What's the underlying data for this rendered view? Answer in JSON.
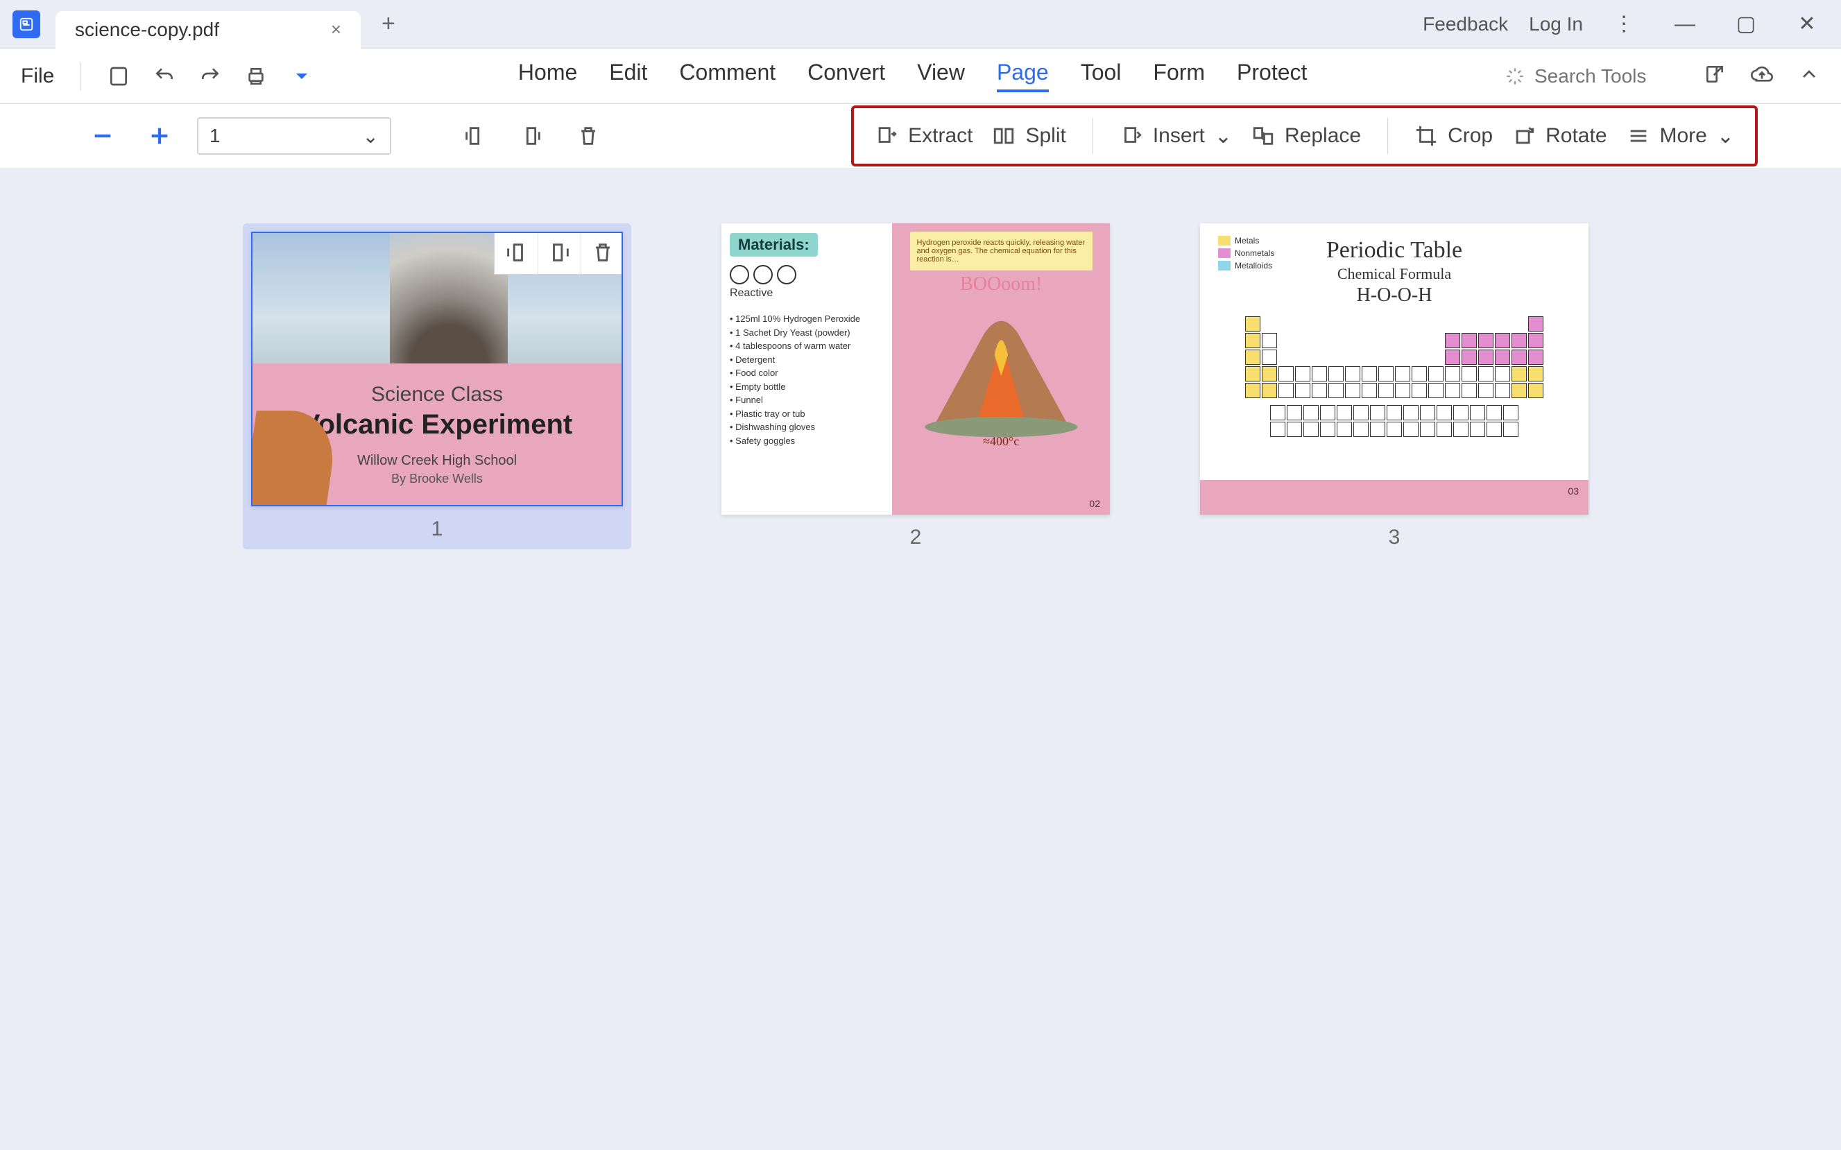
{
  "titlebar": {
    "filename": "science-copy.pdf",
    "feedback": "Feedback",
    "login": "Log In"
  },
  "file_label": "File",
  "menu": {
    "home": "Home",
    "edit": "Edit",
    "comment": "Comment",
    "convert": "Convert",
    "view": "View",
    "page": "Page",
    "tool": "Tool",
    "form": "Form",
    "protect": "Protect"
  },
  "search_placeholder": "Search Tools",
  "page_input": "1",
  "page_tools": {
    "extract": "Extract",
    "split": "Split",
    "insert": "Insert",
    "replace": "Replace",
    "crop": "Crop",
    "rotate": "Rotate",
    "more": "More"
  },
  "thumbs": {
    "p1": {
      "num": "1",
      "line1": "Science Class",
      "line2": "Volcanic Experiment",
      "line3": "Willow Creek High School",
      "line4": "By Brooke Wells"
    },
    "p2": {
      "num": "2",
      "materials_badge": "Materials:",
      "mol_label": "Reactive",
      "list": [
        "• 125ml 10% Hydrogen Peroxide",
        "• 1 Sachet Dry Yeast (powder)",
        "• 4 tablespoons of warm water",
        "• Detergent",
        "• Food color",
        "• Empty bottle",
        "• Funnel",
        "• Plastic tray or tub",
        "• Dishwashing gloves",
        "• Safety goggles"
      ],
      "note": "Hydrogen peroxide reacts quickly, releasing water and oxygen gas. The chemical equation for this reaction is…",
      "boom": "BOOoom!",
      "temp": "≈400°c",
      "pg": "02"
    },
    "p3": {
      "num": "3",
      "title": "Periodic Table",
      "sub": "Chemical Formula",
      "formula": "H-O-O-H",
      "legend": [
        "Metals",
        "Nonmetals",
        "Metalloids"
      ],
      "pg": "03"
    }
  }
}
